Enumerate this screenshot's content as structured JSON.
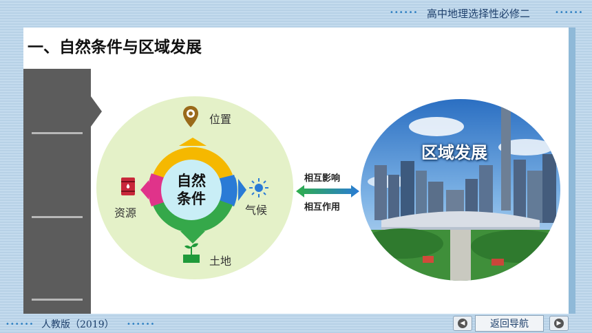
{
  "header": {
    "subject": "高中地理选择性必修二",
    "dots_left": "••••••",
    "dots_right": "••••••"
  },
  "slide": {
    "title": "一、自然条件与区域发展"
  },
  "diagram": {
    "center_label_line1": "自然",
    "center_label_line2": "条件",
    "factors": {
      "top": "位置",
      "right": "气候",
      "bottom": "土地",
      "left": "资源"
    },
    "factor_icons": {
      "top": "location-pin-icon",
      "right": "sun-icon",
      "bottom": "sprout-icon",
      "left": "barrel-icon"
    },
    "segment_colors": {
      "top": "#f5b800",
      "right": "#2a7bd6",
      "bottom": "#35a84a",
      "left": "#e0338a"
    },
    "arrow_label_top": "相互影响",
    "arrow_label_bottom": "相互作用",
    "region_label": "区域发展"
  },
  "footer": {
    "publisher": "人教版（2019）",
    "dots": "••••••",
    "home_label": "返回导航",
    "prev_icon": "prev-arrow-icon",
    "next_icon": "next-arrow-icon"
  }
}
